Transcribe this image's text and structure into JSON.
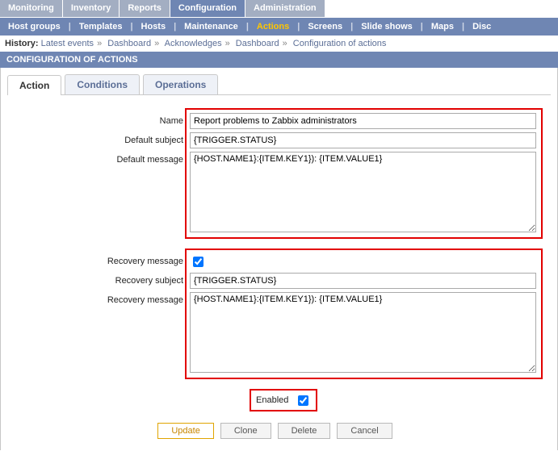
{
  "nav": {
    "main": [
      "Monitoring",
      "Inventory",
      "Reports",
      "Configuration",
      "Administration"
    ],
    "main_active": 3,
    "sub": [
      "Host groups",
      "Templates",
      "Hosts",
      "Maintenance",
      "Actions",
      "Screens",
      "Slide shows",
      "Maps",
      "Disc"
    ],
    "sub_active": 4
  },
  "history": {
    "label": "History:",
    "items": [
      "Latest events",
      "Dashboard",
      "Acknowledges",
      "Dashboard",
      "Configuration of actions"
    ]
  },
  "title": "CONFIGURATION OF ACTIONS",
  "tabs": {
    "items": [
      "Action",
      "Conditions",
      "Operations"
    ],
    "active": 0
  },
  "form": {
    "name_label": "Name",
    "name_value": "Report problems to Zabbix administrators",
    "default_subject_label": "Default subject",
    "default_subject_value": "{TRIGGER.STATUS}",
    "default_message_label": "Default message",
    "default_message_value": "{HOST.NAME1}:{ITEM.KEY1}): {ITEM.VALUE1}",
    "recovery_message_label": "Recovery message",
    "recovery_message_checked": true,
    "recovery_subject_label": "Recovery subject",
    "recovery_subject_value": "{TRIGGER.STATUS}",
    "recovery_msg_label": "Recovery message",
    "recovery_msg_value": "{HOST.NAME1}:{ITEM.KEY1}): {ITEM.VALUE1}",
    "enabled_label": "Enabled",
    "enabled_checked": true
  },
  "buttons": {
    "update": "Update",
    "clone": "Clone",
    "delete": "Delete",
    "cancel": "Cancel"
  }
}
